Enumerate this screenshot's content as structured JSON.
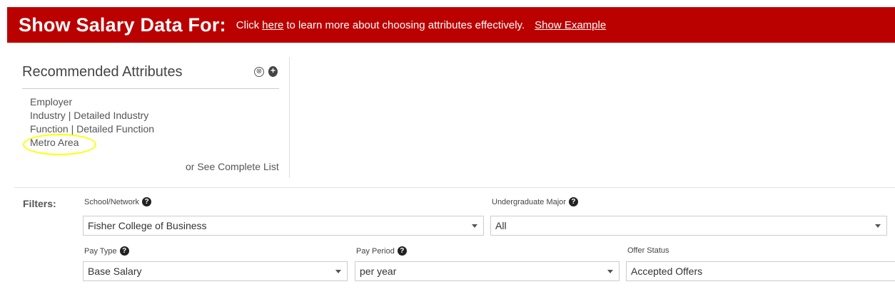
{
  "banner": {
    "title": "Show Salary Data For:",
    "text_prefix": "Click",
    "here_link": "here",
    "text_suffix": "to learn more about choosing attributes effectively.",
    "example_link": "Show Example"
  },
  "recommended": {
    "title": "Recommended Attributes",
    "remove_icon": "⊗",
    "add_icon": "+",
    "items": [
      "Employer",
      "Industry | Detailed Industry",
      "Function | Detailed Function",
      "Metro Area"
    ],
    "see_complete": "or See Complete List"
  },
  "filters": {
    "label": "Filters:",
    "school_label": "School/Network",
    "school_value": "Fisher College of Business",
    "major_label": "Undergraduate Major",
    "major_value": "All",
    "pay_type_label": "Pay Type",
    "pay_type_value": "Base Salary",
    "pay_period_label": "Pay Period",
    "pay_period_value": "per year",
    "offer_status_label": "Offer Status",
    "offer_status_value": "Accepted Offers",
    "help_icon": "?"
  }
}
